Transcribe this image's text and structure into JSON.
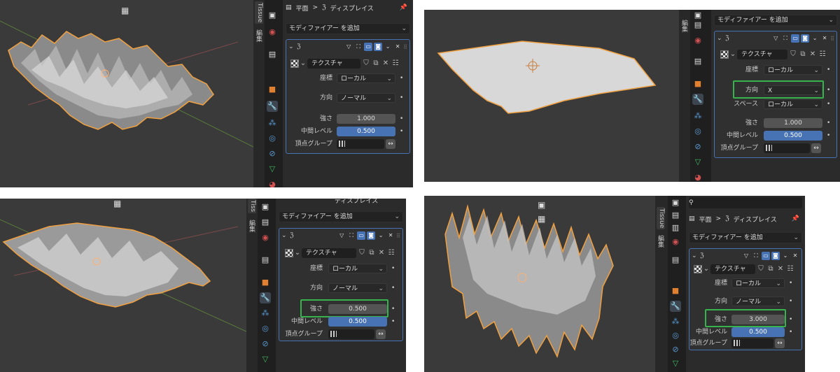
{
  "q1": {
    "tabs": {
      "tissue": "Tissue",
      "edit": "編集"
    },
    "header": {
      "mesh": "平面",
      "sep": ">",
      "modifier": "ディスプレイス",
      "pin_icon": "pin-icon"
    },
    "add_modifier": "モディファイアー を追加",
    "tex_name": "テクスチャ",
    "coord": {
      "label": "座標",
      "value": "ローカル"
    },
    "direction": {
      "label": "方向",
      "value": "ノーマル"
    },
    "strength": {
      "label": "強さ",
      "value": "1.000"
    },
    "midlevel": {
      "label": "中間レベル",
      "value": "0.500"
    },
    "vgroup": {
      "label": "頂点グループ"
    }
  },
  "q2": {
    "tabs": {
      "edit": "編集"
    },
    "add_modifier": "モディファイアー を追加",
    "tex_name": "テクスチャ",
    "coord": {
      "label": "座標",
      "value": "ローカル"
    },
    "direction": {
      "label": "方向",
      "value": "X"
    },
    "space": {
      "label": "スペース",
      "value": "ローカル"
    },
    "strength": {
      "label": "強さ",
      "value": "1.000"
    },
    "midlevel": {
      "label": "中間レベル",
      "value": "0.500"
    },
    "vgroup": {
      "label": "頂点グループ"
    }
  },
  "q3": {
    "tabs": {
      "tissue": "Tiss",
      "edit": "編集"
    },
    "header": {
      "modifier": "ディスプレイス"
    },
    "add_modifier": "モディファイアー を追加",
    "tex_name": "テクスチャ",
    "coord": {
      "label": "座標",
      "value": "ローカル"
    },
    "direction": {
      "label": "方向",
      "value": "ノーマル"
    },
    "strength": {
      "label": "強さ",
      "value": "0.500"
    },
    "midlevel": {
      "label": "中間レベル",
      "value": "0.500"
    },
    "vgroup": {
      "label": "頂点グループ"
    }
  },
  "q4": {
    "tabs": {
      "tissue": "Tissue",
      "edit": "編集"
    },
    "header": {
      "mesh": "平面",
      "sep": ">",
      "modifier": "ディスプレイス"
    },
    "add_modifier": "モディファイアー を追加",
    "tex_name": "テクスチャ",
    "coord": {
      "label": "座標",
      "value": "ローカル"
    },
    "direction": {
      "label": "方向",
      "value": "ノーマル"
    },
    "strength": {
      "label": "強さ",
      "value": "3.000"
    },
    "midlevel": {
      "label": "中間レベル",
      "value": "0.500"
    },
    "vgroup": {
      "label": "頂点グループ"
    }
  },
  "colors": {
    "accent": "#4772b3",
    "highlight": "#37b24d",
    "outline": "#f0a040"
  }
}
